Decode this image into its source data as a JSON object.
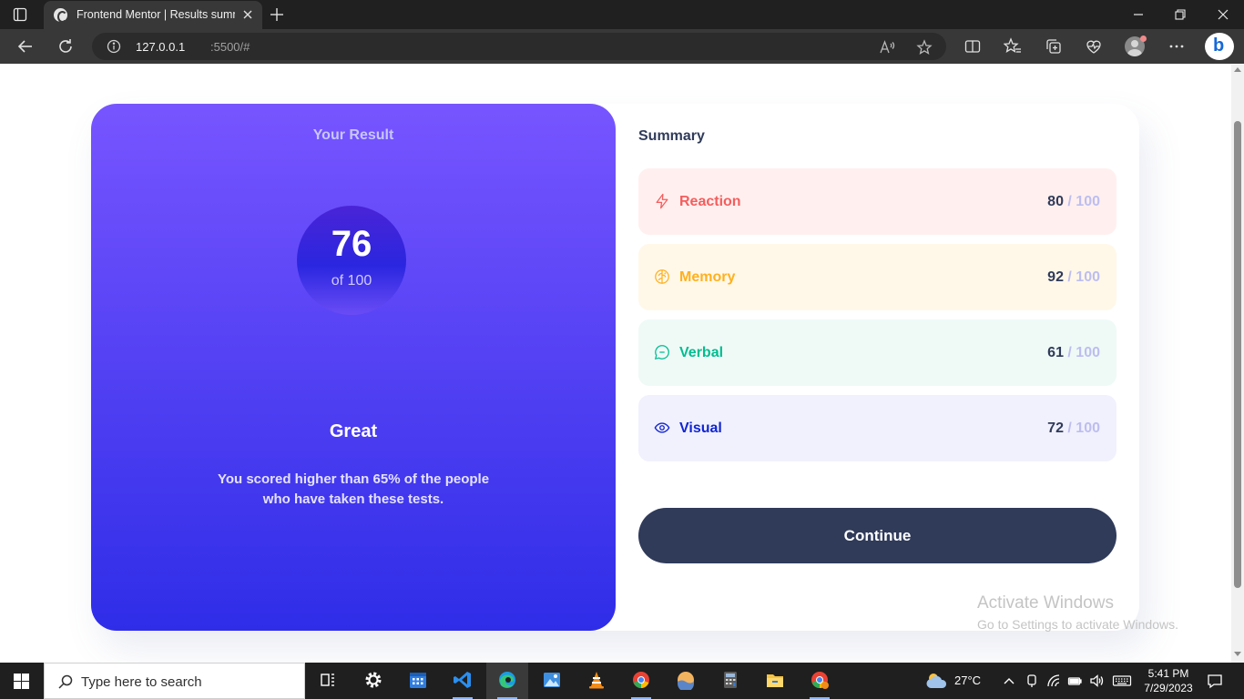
{
  "browser": {
    "tab_title": "Frontend Mentor | Results summary component",
    "url_host": "127.0.0.1",
    "url_path": ":5500/#"
  },
  "result": {
    "heading": "Your Result",
    "score": "76",
    "of_total": "of 100",
    "rating": "Great",
    "description": "You scored higher than 65% of the people who have taken these tests."
  },
  "summary": {
    "heading": "Summary",
    "items": [
      {
        "label": "Reaction",
        "score": "80",
        "max": " / 100",
        "icon": "lightning-icon",
        "color": "#f55d5d",
        "bg": "#fff0ef"
      },
      {
        "label": "Memory",
        "score": "92",
        "max": " / 100",
        "icon": "brain-icon",
        "color": "#ffb01f",
        "bg": "#fff8e9"
      },
      {
        "label": "Verbal",
        "score": "61",
        "max": " / 100",
        "icon": "chat-bubble-icon",
        "color": "#00bd90",
        "bg": "#effaf7"
      },
      {
        "label": "Visual",
        "score": "72",
        "max": " / 100",
        "icon": "eye-icon",
        "color": "#1125d4",
        "bg": "#f1f1fd"
      }
    ],
    "continue_label": "Continue"
  },
  "watermark": {
    "title": "Activate Windows",
    "subtitle": "Go to Settings to activate Windows."
  },
  "taskbar": {
    "search_placeholder": "Type here to search",
    "temperature": "27°C",
    "time": "5:41 PM",
    "date": "7/29/2023"
  },
  "colors": {
    "gradient_top": "#7755ff",
    "gradient_bottom": "#2f2de8",
    "dark_navy": "#303b5a"
  }
}
